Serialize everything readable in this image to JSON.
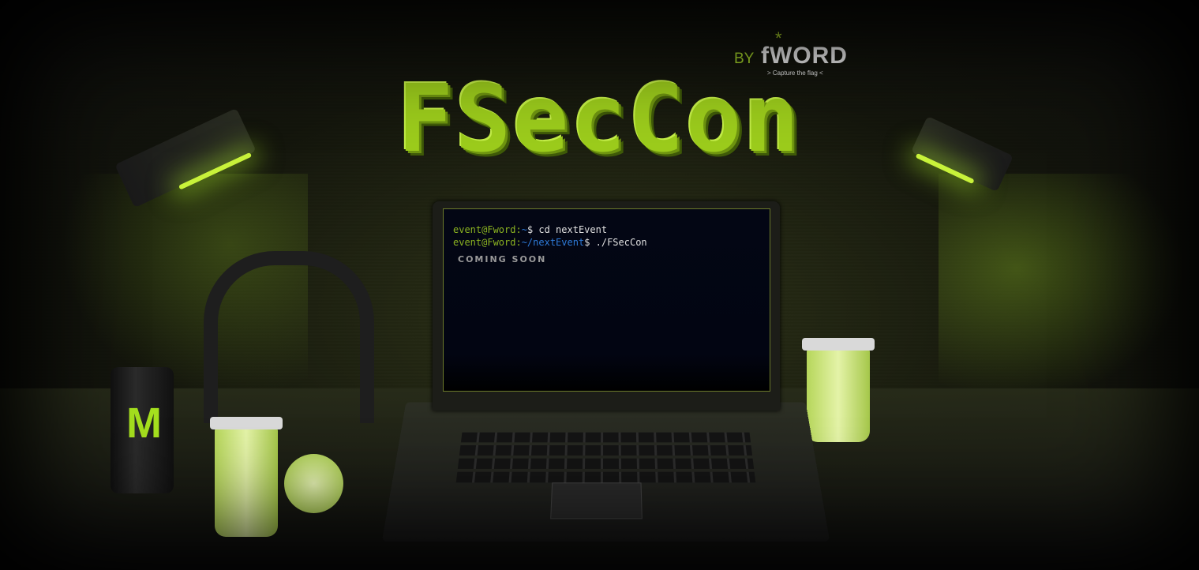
{
  "header": {
    "title": "FSecCon",
    "by_label": "BY",
    "brand_name": "fWORD",
    "brand_star": "*",
    "brand_tagline": "> Capture the flag <"
  },
  "terminal": {
    "line1": {
      "user": "event@Fword:",
      "path": "~",
      "command": "$ cd nextEvent"
    },
    "line2": {
      "user": "event@Fword:",
      "path": "~/nextEvent",
      "command": "$ ./FSecCon"
    },
    "status": "COMING SOON"
  },
  "props": {
    "can_logo": "M"
  },
  "colors": {
    "accent": "#9ccc1c",
    "prompt_user": "#8bb321",
    "prompt_path": "#2e7bd9",
    "terminal_bg": "#020512"
  }
}
